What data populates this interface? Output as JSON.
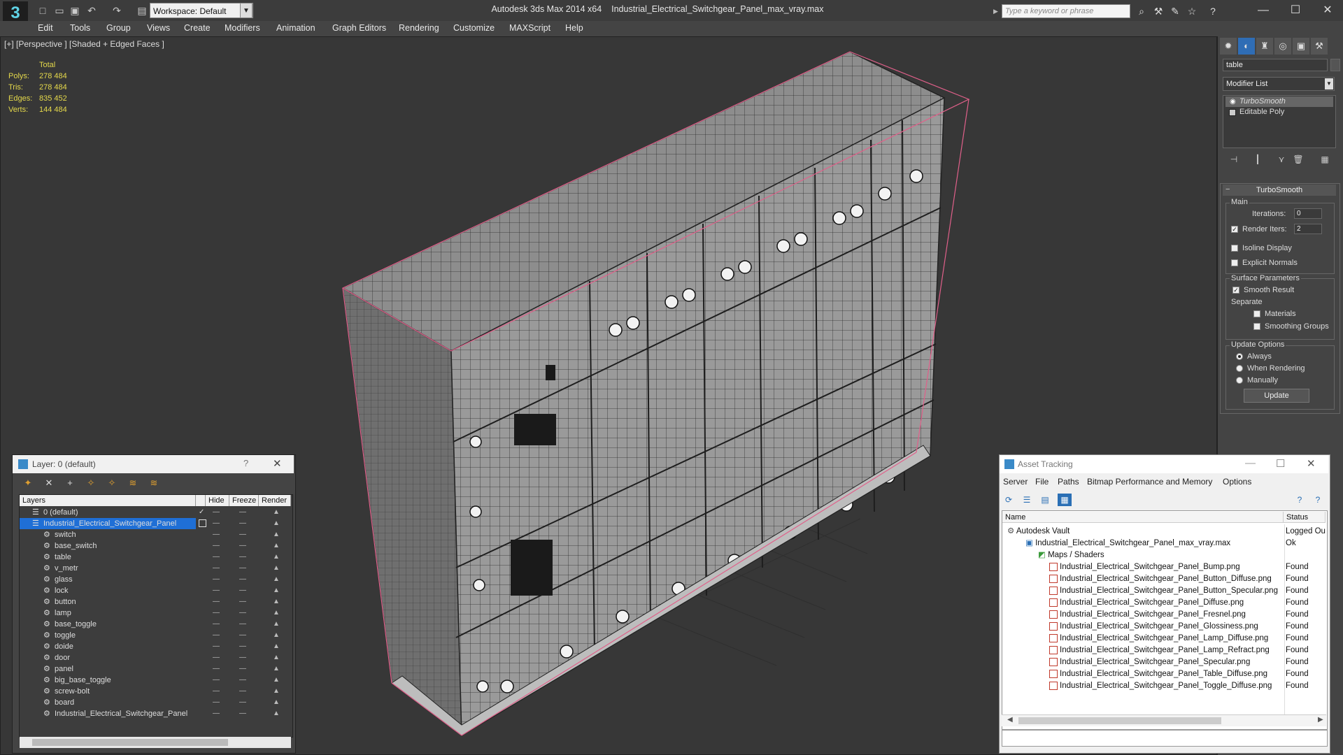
{
  "titlebar": {
    "app": "Autodesk 3ds Max  2014 x64",
    "file": "Industrial_Electrical_Switchgear_Panel_max_vray.max",
    "workspace": "Workspace: Default",
    "search_placeholder": "Type a keyword or phrase"
  },
  "menu": [
    "Edit",
    "Tools",
    "Group",
    "Views",
    "Create",
    "Modifiers",
    "Animation",
    "Graph Editors",
    "Rendering",
    "Customize",
    "MAXScript",
    "Help"
  ],
  "viewport": {
    "label": "[+] [Perspective ] [Shaded + Edged Faces ]",
    "stats": {
      "header": "Total",
      "rows": [
        {
          "label": "Polys:",
          "value": "278 484"
        },
        {
          "label": "Tris:",
          "value": "278 484"
        },
        {
          "label": "Edges:",
          "value": "835 452"
        },
        {
          "label": "Verts:",
          "value": "144 484"
        }
      ]
    }
  },
  "command_panel": {
    "object_name": "table",
    "modifier_list": "Modifier List",
    "stack": [
      "TurboSmooth",
      "Editable Poly"
    ],
    "rollout": "TurboSmooth",
    "main": "Main",
    "iterations_label": "Iterations:",
    "iterations_value": "0",
    "render_iters_label": "Render Iters:",
    "render_iters_value": "2",
    "isoline": "Isoline Display",
    "explicit_normals": "Explicit Normals",
    "surface_params": "Surface Parameters",
    "smooth_result": "Smooth Result",
    "separate": "Separate",
    "materials": "Materials",
    "smoothing_groups": "Smoothing Groups",
    "update_options": "Update Options",
    "always": "Always",
    "when_rendering": "When Rendering",
    "manually": "Manually",
    "update_button": "Update"
  },
  "layer_dialog": {
    "title": "Layer: 0 (default)",
    "help": "?",
    "columns": [
      "Layers",
      "Hide",
      "Freeze",
      "Render"
    ],
    "rows": [
      {
        "name": "0 (default)",
        "level": 0
      },
      {
        "name": "Industrial_Electrical_Switchgear_Panel",
        "level": 0
      },
      {
        "name": "switch",
        "level": 1
      },
      {
        "name": "base_switch",
        "level": 1
      },
      {
        "name": "table",
        "level": 1
      },
      {
        "name": "v_metr",
        "level": 1
      },
      {
        "name": "glass",
        "level": 1
      },
      {
        "name": "lock",
        "level": 1
      },
      {
        "name": "button",
        "level": 1
      },
      {
        "name": "lamp",
        "level": 1
      },
      {
        "name": "base_toggle",
        "level": 1
      },
      {
        "name": "toggle",
        "level": 1
      },
      {
        "name": "doide",
        "level": 1
      },
      {
        "name": "door",
        "level": 1
      },
      {
        "name": "panel",
        "level": 1
      },
      {
        "name": "big_base_toggle",
        "level": 1
      },
      {
        "name": "screw-bolt",
        "level": 1
      },
      {
        "name": "board",
        "level": 1
      },
      {
        "name": "Industrial_Electrical_Switchgear_Panel",
        "level": 1
      }
    ]
  },
  "asset_tracking": {
    "title": "Asset Tracking",
    "menu": [
      "Server",
      "File",
      "Paths",
      "Bitmap Performance and Memory",
      "Options"
    ],
    "columns": [
      "Name",
      "Status"
    ],
    "rows": [
      {
        "name": "Autodesk Vault",
        "status": "Logged Ou",
        "level": 0
      },
      {
        "name": "Industrial_Electrical_Switchgear_Panel_max_vray.max",
        "status": "Ok",
        "level": 1
      },
      {
        "name": "Maps / Shaders",
        "status": "",
        "level": 2
      },
      {
        "name": "Industrial_Electrical_Switchgear_Panel_Bump.png",
        "status": "Found",
        "level": 3
      },
      {
        "name": "Industrial_Electrical_Switchgear_Panel_Button_Diffuse.png",
        "status": "Found",
        "level": 3
      },
      {
        "name": "Industrial_Electrical_Switchgear_Panel_Button_Specular.png",
        "status": "Found",
        "level": 3
      },
      {
        "name": "Industrial_Electrical_Switchgear_Panel_Diffuse.png",
        "status": "Found",
        "level": 3
      },
      {
        "name": "Industrial_Electrical_Switchgear_Panel_Fresnel.png",
        "status": "Found",
        "level": 3
      },
      {
        "name": "Industrial_Electrical_Switchgear_Panel_Glossiness.png",
        "status": "Found",
        "level": 3
      },
      {
        "name": "Industrial_Electrical_Switchgear_Panel_Lamp_Diffuse.png",
        "status": "Found",
        "level": 3
      },
      {
        "name": "Industrial_Electrical_Switchgear_Panel_Lamp_Refract.png",
        "status": "Found",
        "level": 3
      },
      {
        "name": "Industrial_Electrical_Switchgear_Panel_Specular.png",
        "status": "Found",
        "level": 3
      },
      {
        "name": "Industrial_Electrical_Switchgear_Panel_Table_Diffuse.png",
        "status": "Found",
        "level": 3
      },
      {
        "name": "Industrial_Electrical_Switchgear_Panel_Toggle_Diffuse.png",
        "status": "Found",
        "level": 3
      }
    ]
  },
  "colors": {
    "stats": "#e5d94b",
    "selection": "#1f6fd6",
    "bbox": "#e0608a"
  }
}
